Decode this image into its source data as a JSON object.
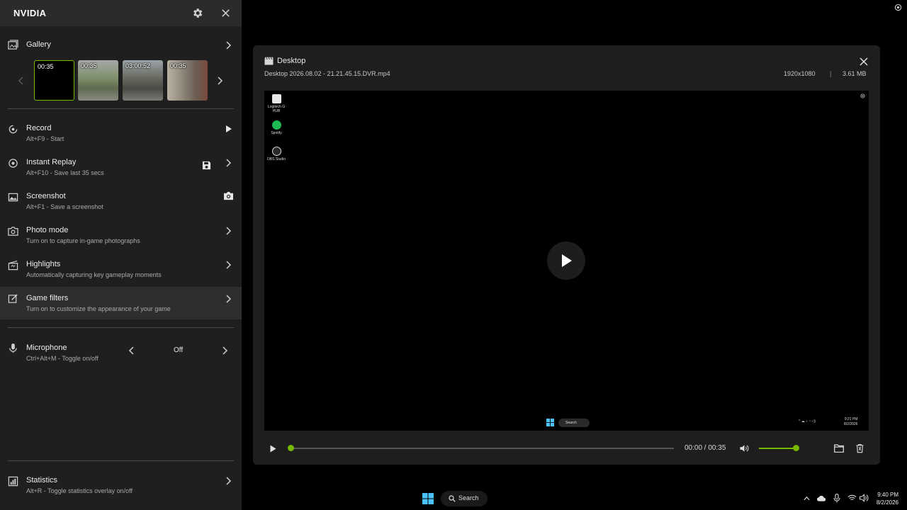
{
  "sidebar": {
    "title": "NVIDIA",
    "gallery": {
      "label": "Gallery",
      "thumbnails": [
        {
          "time": "00:35",
          "selected": true
        },
        {
          "time": "00:35",
          "selected": false
        },
        {
          "time": "03:00:52",
          "selected": false
        },
        {
          "time": "00:35",
          "selected": false
        }
      ]
    },
    "record": {
      "label": "Record",
      "sub": "Alt+F9 - Start"
    },
    "instant_replay": {
      "label": "Instant Replay",
      "sub": "Alt+F10 - Save last 35 secs"
    },
    "screenshot": {
      "label": "Screenshot",
      "sub": "Alt+F1 - Save a screenshot"
    },
    "photo_mode": {
      "label": "Photo mode",
      "sub": "Turn on to capture in-game photographs"
    },
    "highlights": {
      "label": "Highlights",
      "sub": "Automatically capturing key gameplay moments"
    },
    "game_filters": {
      "label": "Game filters",
      "sub": "Turn on to customize the appearance of your game"
    },
    "microphone": {
      "label": "Microphone",
      "sub": "Ctrl+Alt+M - Toggle on/off",
      "value": "Off"
    },
    "statistics": {
      "label": "Statistics",
      "sub": "Alt+R - Toggle statistics overlay on/off"
    }
  },
  "player": {
    "title": "Desktop",
    "filename": "Desktop 2026.08.02 - 21.21.45.15.DVR.mp4",
    "resolution": "1920x1080",
    "separator": "|",
    "filesize": "3.61 MB",
    "time": "00:00 / 00:35",
    "progress": 0,
    "volume": 1.0,
    "desktop_icons": [
      {
        "label": "Logitech G HUB"
      },
      {
        "label": "Spotify"
      },
      {
        "label": "OBS Studio"
      }
    ],
    "mini_taskbar": {
      "search": "Search",
      "time": "9:21 PM",
      "date": "8/2/2026"
    }
  },
  "taskbar": {
    "search": "Search",
    "time": "9:40 PM",
    "date": "8/2/2026"
  },
  "colors": {
    "accent": "#76b900",
    "panel": "#1e1e1e",
    "sidebar": "#1f1f1f"
  }
}
